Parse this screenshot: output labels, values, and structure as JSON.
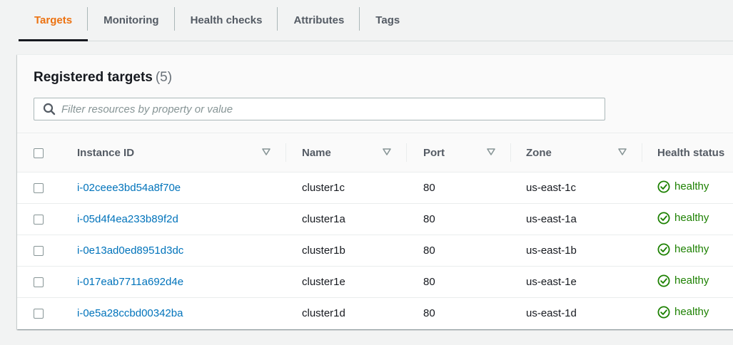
{
  "tabs": [
    {
      "label": "Targets",
      "active": true
    },
    {
      "label": "Monitoring",
      "active": false
    },
    {
      "label": "Health checks",
      "active": false
    },
    {
      "label": "Attributes",
      "active": false
    },
    {
      "label": "Tags",
      "active": false
    }
  ],
  "panel": {
    "title": "Registered targets",
    "count": "(5)",
    "filter_placeholder": "Filter resources by property or value"
  },
  "table": {
    "columns": [
      "Instance ID",
      "Name",
      "Port",
      "Zone",
      "Health status"
    ],
    "rows": [
      {
        "instance_id": "i-02ceee3bd54a8f70e",
        "name": "cluster1c",
        "port": "80",
        "zone": "us-east-1c",
        "health": "healthy"
      },
      {
        "instance_id": "i-05d4f4ea233b89f2d",
        "name": "cluster1a",
        "port": "80",
        "zone": "us-east-1a",
        "health": "healthy"
      },
      {
        "instance_id": "i-0e13ad0ed8951d3dc",
        "name": "cluster1b",
        "port": "80",
        "zone": "us-east-1b",
        "health": "healthy"
      },
      {
        "instance_id": "i-017eab7711a692d4e",
        "name": "cluster1e",
        "port": "80",
        "zone": "us-east-1e",
        "health": "healthy"
      },
      {
        "instance_id": "i-0e5a28ccbd00342ba",
        "name": "cluster1d",
        "port": "80",
        "zone": "us-east-1d",
        "health": "healthy"
      }
    ]
  },
  "icons": {
    "search": "search-icon",
    "sort": "sort-down-icon",
    "status_ok": "status-positive-icon"
  },
  "colors": {
    "active_tab": "#ec7211",
    "link": "#0073bb",
    "healthy": "#1d8102"
  }
}
